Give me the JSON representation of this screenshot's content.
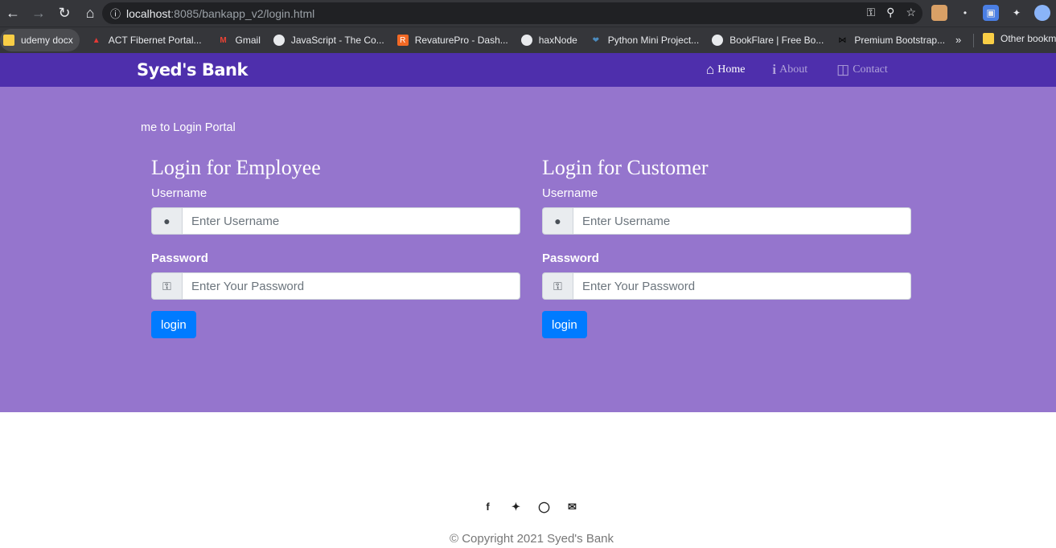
{
  "browser": {
    "url_host": "localhost",
    "url_path": ":8085/bankapp_v2/login.html",
    "bookmarks": [
      {
        "label": "udemy docx",
        "icon": "folder-icon",
        "color": "#f9ce46"
      },
      {
        "label": "ACT Fibernet Portal...",
        "icon": "act-icon",
        "color": "#e53935"
      },
      {
        "label": "Gmail",
        "icon": "gmail-icon",
        "color": "#ea4335"
      },
      {
        "label": "JavaScript - The Co...",
        "icon": "globe-icon",
        "color": "#e8eaed"
      },
      {
        "label": "RevaturePro - Dash...",
        "icon": "revature-icon",
        "color": "#f26925"
      },
      {
        "label": "haxNode",
        "icon": "globe-icon",
        "color": "#e8eaed"
      },
      {
        "label": "Python Mini Project...",
        "icon": "python-icon",
        "color": "#4b8bbe"
      },
      {
        "label": "BookFlare | Free Bo...",
        "icon": "globe-icon",
        "color": "#e8eaed"
      },
      {
        "label": "Premium Bootstrap...",
        "icon": "bowtie-icon",
        "color": "#000000"
      }
    ],
    "more": "»",
    "other_bookmarks": "Other bookm"
  },
  "navbar": {
    "brand": "Syed's Bank",
    "links": {
      "home": "Home",
      "about": "About",
      "contact": "Contact"
    },
    "color": "#4e2fac"
  },
  "hero": {
    "marquee": "me to Login Portal",
    "color": "#9575cd",
    "employee": {
      "title": "Login for Employee",
      "username_label": "Username",
      "username_placeholder": "Enter Username",
      "password_label": "Password",
      "password_placeholder": "Enter Your Password",
      "button": "login"
    },
    "customer": {
      "title": "Login for Customer",
      "username_label": "Username",
      "username_placeholder": "Enter Username",
      "password_label": "Password",
      "password_placeholder": "Enter Your Password",
      "button": "login"
    }
  },
  "footer": {
    "social": [
      "facebook-icon",
      "twitter-icon",
      "instagram-icon",
      "envelope-icon"
    ],
    "copyright": "© Copyright 2021 Syed's Bank"
  }
}
